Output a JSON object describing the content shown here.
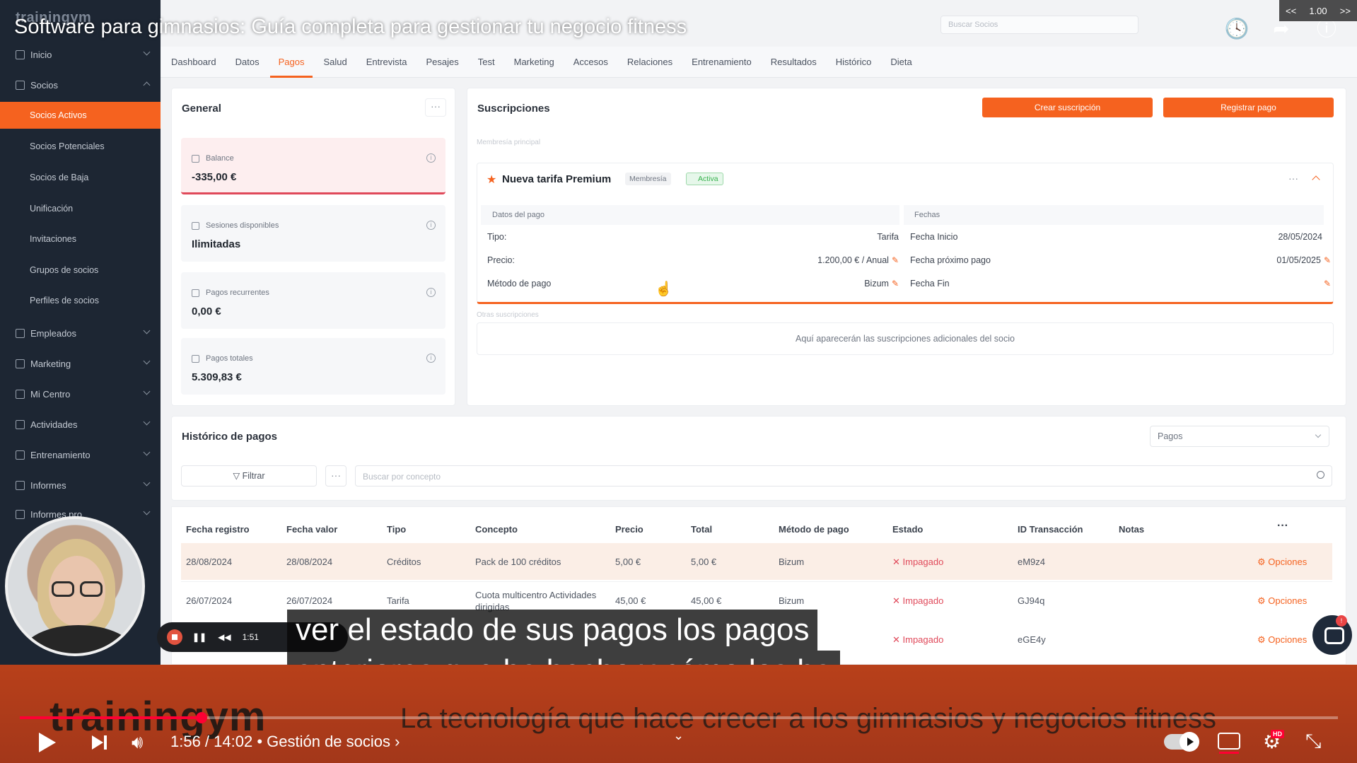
{
  "video": {
    "title": "Software para gimnasios: Guía completa para gestionar tu negocio fitness",
    "speed": "1.00",
    "speed_down": "<<",
    "speed_up": ">>",
    "time": "1:56 / 14:02 • Gestión de socios ›",
    "progress": 0.1378,
    "captions": [
      "ver el estado de sus pagos los pagos",
      "anteriores que ha hecho y cómo los ha"
    ],
    "recorder_time": "1:51"
  },
  "app": {
    "logo": "trainingym",
    "search_placeholder": "Buscar Socios",
    "sidebar": {
      "items": [
        {
          "label": "Inicio"
        },
        {
          "label": "Socios"
        },
        {
          "label": "Empleados"
        },
        {
          "label": "Marketing"
        },
        {
          "label": "Mi Centro"
        },
        {
          "label": "Actividades"
        },
        {
          "label": "Entrenamiento"
        },
        {
          "label": "Informes"
        },
        {
          "label": "Informes pro"
        }
      ],
      "sub_items": [
        {
          "label": "Socios Activos"
        },
        {
          "label": "Socios Potenciales"
        },
        {
          "label": "Socios de Baja"
        },
        {
          "label": "Unificación"
        },
        {
          "label": "Invitaciones"
        },
        {
          "label": "Grupos de socios"
        },
        {
          "label": "Perfiles de socios"
        }
      ]
    },
    "tabs": [
      "Dashboard",
      "Datos",
      "Pagos",
      "Salud",
      "Entrevista",
      "Pesajes",
      "Test",
      "Marketing",
      "Accesos",
      "Relaciones",
      "Entrenamiento",
      "Resultados",
      "Histórico",
      "Dieta"
    ],
    "active_tab": "Pagos",
    "general": {
      "title": "General",
      "cards": [
        {
          "label": "Balance",
          "value": "-335,00 €"
        },
        {
          "label": "Sesiones disponibles",
          "value": "Ilimitadas"
        },
        {
          "label": "Pagos recurrentes",
          "value": "0,00 €"
        },
        {
          "label": "Pagos totales",
          "value": "5.309,83 €"
        }
      ]
    },
    "subscriptions": {
      "title": "Suscripciones",
      "create_label": "Crear suscripción",
      "pay_label": "Registrar pago",
      "main_label": "Membresía principal",
      "plan_name": "Nueva tarifa Premium",
      "plan_tag": "Membresía",
      "plan_status": "Activa",
      "payment_header": "Datos del pago",
      "dates_header": "Fechas",
      "tipo_label": "Tipo:",
      "tipo_value": "Tarifa",
      "precio_label": "Precio:",
      "precio_value": "1.200,00 € / Anual",
      "metodo_label": "Método de pago",
      "metodo_value": "Bizum",
      "inicio_label": "Fecha Inicio",
      "inicio_value": "28/05/2024",
      "proximo_label": "Fecha próximo pago",
      "proximo_value": "01/05/2025",
      "fin_label": "Fecha Fin",
      "other_label": "Otras suscripciones",
      "empty_text": "Aquí aparecerán las suscripciones adicionales del socio"
    },
    "history": {
      "title": "Histórico de pagos",
      "select_value": "Pagos",
      "filter_label": "Filtrar",
      "search_placeholder": "Buscar por concepto",
      "columns": [
        "Fecha registro",
        "Fecha valor",
        "Tipo",
        "Concepto",
        "Precio",
        "Total",
        "Método de pago",
        "Estado",
        "ID Transacción",
        "Notas"
      ],
      "rows": [
        {
          "registro": "28/08/2024",
          "valor": "28/08/2024",
          "tipo": "Créditos",
          "concepto": "Pack de 100 créditos",
          "precio": "5,00 €",
          "total": "5,00 €",
          "metodo": "Bizum",
          "estado": "Impagado",
          "id": "eM9z4",
          "opciones": "Opciones"
        },
        {
          "registro": "26/07/2024",
          "valor": "26/07/2024",
          "tipo": "Tarifa",
          "concepto": "Cuota multicentro Actividades dirigidas",
          "precio": "45,00 €",
          "total": "45,00 €",
          "metodo": "Bizum",
          "estado": "Impagado",
          "id": "GJ94q",
          "opciones": "Opciones"
        },
        {
          "registro": "",
          "valor": "",
          "tipo": "",
          "concepto": "",
          "precio": "",
          "total": "",
          "metodo": "",
          "estado": "Impagado",
          "id": "eGE4y",
          "opciones": "Opciones"
        }
      ]
    }
  },
  "banner": {
    "brand": "trainingym",
    "slogan": "La tecnología que hace crecer a los gimnasios y negocios fitness"
  },
  "colors": {
    "accent": "#f5621f",
    "sidebar": "#1d2633",
    "danger": "#e0495a",
    "progress": "#ff0033"
  }
}
